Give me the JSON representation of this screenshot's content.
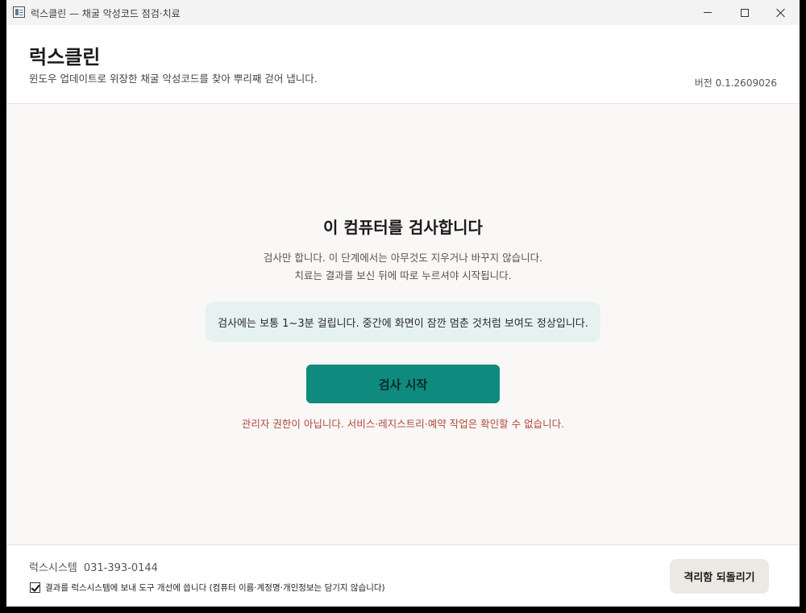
{
  "window": {
    "title": "럭스클린 — 채굴 악성코드 점검·치료"
  },
  "header": {
    "app_name": "럭스클린",
    "tagline": "윈도우 업데이트로 위장한 채굴 악성코드를 찾아 뿌리째 걷어 냅니다.",
    "version": "버전 0.1.2609026"
  },
  "main": {
    "title": "이 컴퓨터를 검사합니다",
    "description_line1": "검사만 합니다. 이 단계에서는 아무것도 지우거나 바꾸지 않습니다.",
    "description_line2": "치료는 결과를 보신 뒤에 따로 누르셔야 시작됩니다.",
    "info": "검사에는 보통 1~3분 걸립니다. 중간에 화면이 잠깐 멈춘 것처럼 보여도 정상입니다.",
    "start_button": "검사 시작",
    "warning": "관리자 권한이 아닙니다. 서비스·레지스트리·예약 작업은 확인할 수 없습니다."
  },
  "footer": {
    "company": "럭스시스템",
    "phone": "031-393-0144",
    "consent_label": "결과를 럭스시스템에 보내 도구 개선에 씁니다 (컴퓨터 이름·계정명·개인정보는 담기지 않습니다)",
    "consent_checked": true,
    "restore_button": "격리함 되돌리기"
  },
  "colors": {
    "accent": "#0e8a7e",
    "info_background": "#e6f2ef",
    "warning": "#b0473a",
    "main_background": "#faf8f6"
  },
  "icons": {
    "app": "app-window-icon",
    "minimize": "minimize-icon",
    "maximize": "maximize-icon",
    "close": "close-icon",
    "checkbox": "checkbox-checked-icon"
  }
}
